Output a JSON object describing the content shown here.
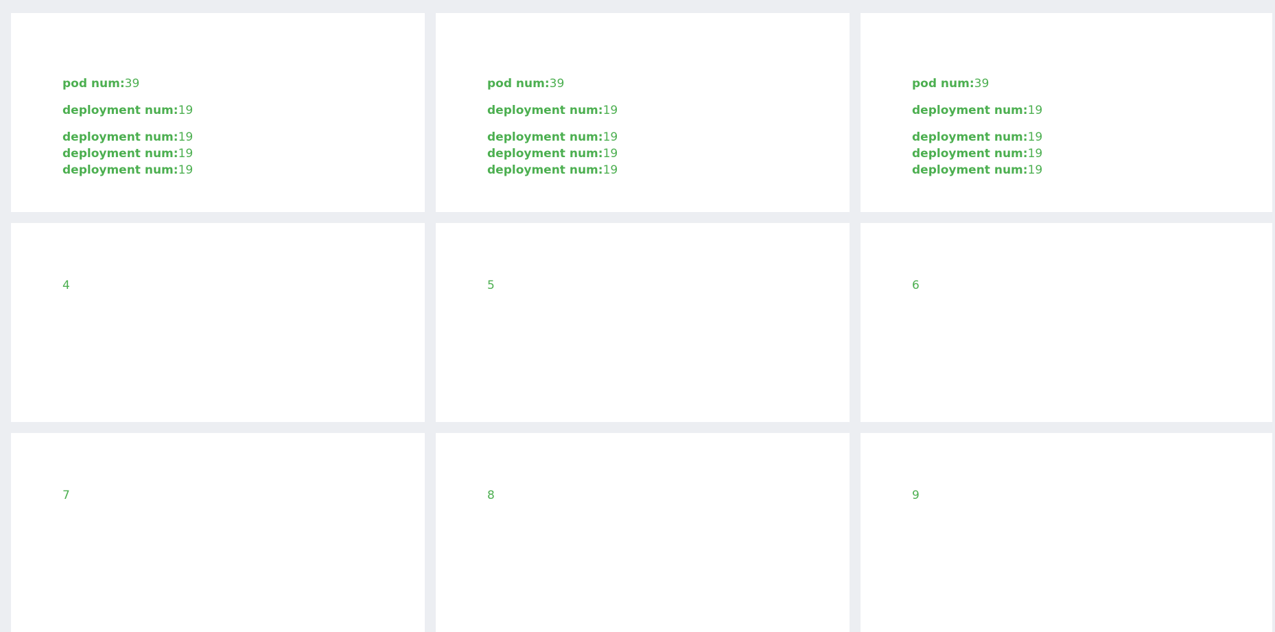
{
  "colors": {
    "background": "#eceef2",
    "card": "#ffffff",
    "text": "#4caf50"
  },
  "cards": [
    {
      "pod_label": "pod num:",
      "pod_value": "39",
      "deploy_label": "deployment num:",
      "deploy_value": "19",
      "extra": [
        {
          "label": "deployment num:",
          "value": "19"
        },
        {
          "label": "deployment num:",
          "value": "19"
        },
        {
          "label": "deployment num:",
          "value": "19"
        }
      ]
    },
    {
      "pod_label": "pod num:",
      "pod_value": "39",
      "deploy_label": "deployment num:",
      "deploy_value": "19",
      "extra": [
        {
          "label": "deployment num:",
          "value": "19"
        },
        {
          "label": "deployment num:",
          "value": "19"
        },
        {
          "label": "deployment num:",
          "value": "19"
        }
      ]
    },
    {
      "pod_label": "pod num:",
      "pod_value": "39",
      "deploy_label": "deployment num:",
      "deploy_value": "19",
      "extra": [
        {
          "label": "deployment num:",
          "value": "19"
        },
        {
          "label": "deployment num:",
          "value": "19"
        },
        {
          "label": "deployment num:",
          "value": "19"
        }
      ]
    }
  ],
  "number_cards": [
    "4",
    "5",
    "6",
    "7",
    "8",
    "9"
  ]
}
